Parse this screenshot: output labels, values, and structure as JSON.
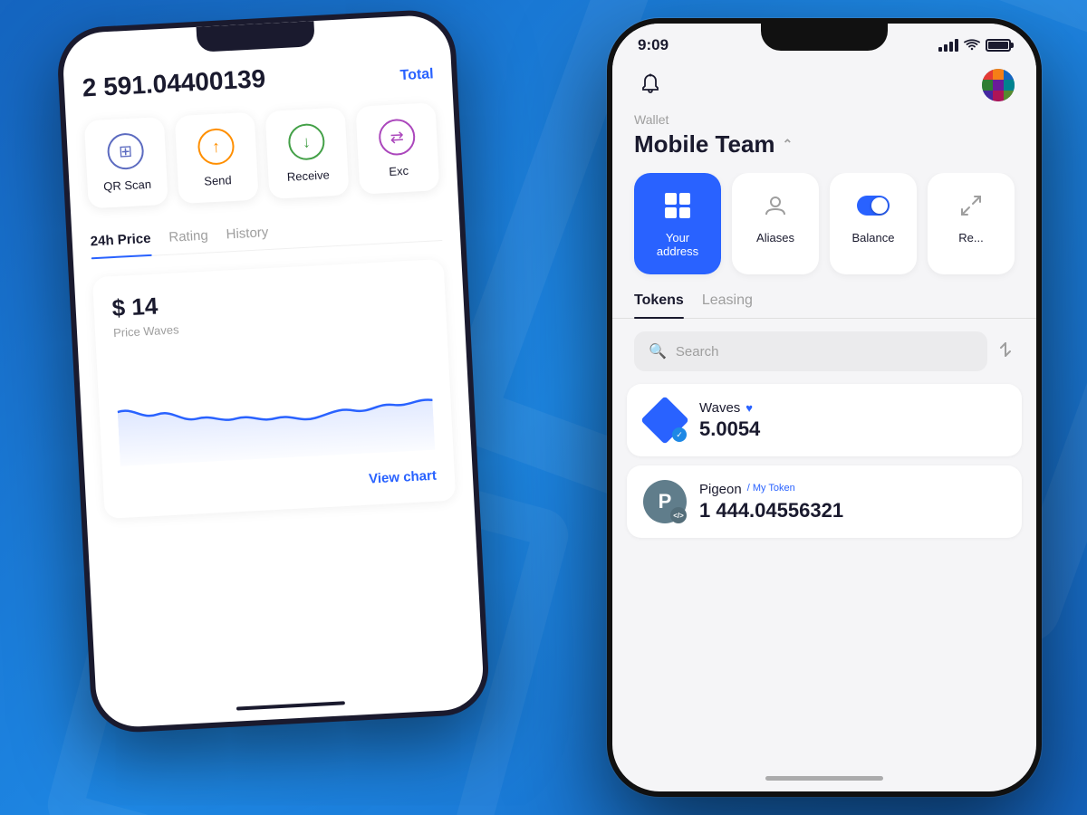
{
  "background": {
    "color": "#1565c0"
  },
  "phone_back": {
    "balance": {
      "amount": "2 591",
      "decimals": ".04400139",
      "label": "Total"
    },
    "actions": [
      {
        "id": "qr-scan",
        "label": "QR Scan",
        "icon": "qr"
      },
      {
        "id": "send",
        "label": "Send",
        "icon": "send"
      },
      {
        "id": "receive",
        "label": "Receive",
        "icon": "receive"
      },
      {
        "id": "exchange",
        "label": "Exc",
        "icon": "exchange"
      }
    ],
    "tabs": [
      {
        "id": "24h-price",
        "label": "24h Price",
        "active": true
      },
      {
        "id": "rating",
        "label": "Rating",
        "active": false
      },
      {
        "id": "history",
        "label": "History",
        "active": false
      }
    ],
    "price": {
      "value": "$ 14",
      "label": "Price Waves"
    },
    "view_chart_label": "View chart"
  },
  "phone_front": {
    "status_bar": {
      "time": "9:09"
    },
    "header": {
      "wallet_label": "Wallet",
      "wallet_name": "Mobile Team"
    },
    "action_cards": [
      {
        "id": "your-address",
        "label": "Your address",
        "active": true
      },
      {
        "id": "aliases",
        "label": "Aliases",
        "active": false
      },
      {
        "id": "balance",
        "label": "Balance",
        "active": false
      },
      {
        "id": "redeem",
        "label": "Re...",
        "active": false
      }
    ],
    "tabs": [
      {
        "id": "tokens",
        "label": "Tokens",
        "active": true
      },
      {
        "id": "leasing",
        "label": "Leasing",
        "active": false
      }
    ],
    "search": {
      "placeholder": "Search"
    },
    "tokens": [
      {
        "id": "waves",
        "name": "Waves",
        "amount": "5.0054",
        "verified": true,
        "favorited": true,
        "icon_type": "diamond"
      },
      {
        "id": "pigeon",
        "name": "Pigeon",
        "sub_label": "/ My Token",
        "amount": "1 444.04556321",
        "icon_letter": "P",
        "icon_type": "letter"
      }
    ]
  }
}
